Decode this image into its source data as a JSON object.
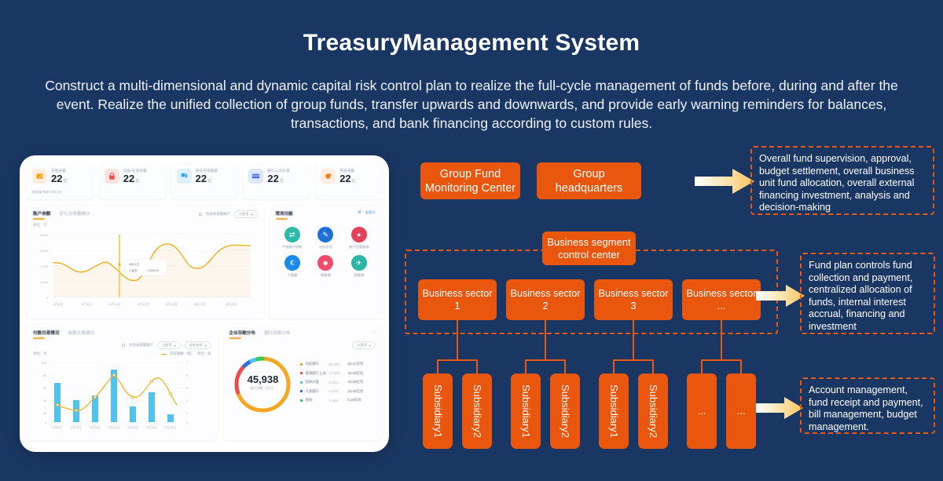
{
  "page": {
    "title": "TreasuryManagement System",
    "subtitle": "Construct a multi-dimensional and dynamic capital risk control plan to realize the full-cycle management of funds before, during and after the event. Realize the unified collection of group funds, transfer upwards and downwards, and provide early warning reminders for balances, transactions, and bank financing according to custom rules.",
    "colors": {
      "background": "#1a3764",
      "accent_orange": "#e8570d",
      "arrow_gold": "#f8c25c",
      "text_white": "#ffffff"
    }
  },
  "diagram": {
    "level1": {
      "boxes": [
        {
          "label": "Group Fund\nMonitoring Center",
          "name": "group-fund-monitoring-center"
        },
        {
          "label": "Group\nheadquarters",
          "name": "group-headquarters"
        }
      ],
      "note": "Overall fund supervision, approval, budget settlement, overall business unit fund allocation, overall external financing investment, analysis and decision-making"
    },
    "level2": {
      "control_center": "Business segment\ncontrol center",
      "sectors": [
        "Business sector\n1",
        "Business sector\n2",
        "Business sector\n3",
        "Business sector\n..."
      ],
      "note": "Fund plan controls fund collection and payment, centralized allocation of funds, internal interest accrual, financing and investment"
    },
    "level3": {
      "groups": [
        [
          "Subsidiary1",
          "Subsidiary2"
        ],
        [
          "Subsidiary1",
          "Subsidiary2"
        ],
        [
          "Subsidiary1",
          "Subsidiary2"
        ],
        [
          "...",
          "..."
        ]
      ],
      "note": "Account management, fund receipt and payment, bill management, budget management."
    }
  },
  "dashboard": {
    "kpis": [
      {
        "label": "可用金额",
        "value": "22",
        "unit": "亿",
        "sub": "保证金  ¥287,663.30",
        "icon": "wallet-icon",
        "icon_bg": "#ffeedd",
        "icon_color": "#f5a623"
      },
      {
        "label": "冻结/在途金额",
        "value": "22",
        "unit": "亿",
        "sub": "",
        "icon": "lock-icon",
        "icon_bg": "#ffe3e3",
        "icon_color": "#ef4b4b"
      },
      {
        "label": "授信可用额度",
        "value": "22",
        "unit": "亿",
        "sub": "",
        "icon": "layers-icon",
        "icon_bg": "#dff0ff",
        "icon_color": "#29a3f5"
      },
      {
        "label": "银行公司存款",
        "value": "22",
        "unit": "亿",
        "sub": "",
        "icon": "card-icon",
        "icon_bg": "#dfe7ff",
        "icon_color": "#4a6cf0"
      },
      {
        "label": "理财金额",
        "value": "22",
        "unit": "亿",
        "sub": "",
        "icon": "piggybank-icon",
        "icon_bg": "#ffeedd",
        "icon_color": "#f57c20"
      }
    ],
    "balance_panel": {
      "tab_active": "账户余额",
      "tab_inactive": "近七日流量统计",
      "checkbox_label": "包含未直联账户",
      "currency": "人民币",
      "unit_label": "单位：万",
      "tooltip": {
        "date": "4月11日",
        "series": "人民币",
        "value": "2,506.06"
      }
    },
    "transaction_panel": {
      "tab_active": "付款交易情况",
      "tab_inactive": "收款交易情况",
      "checkbox_label": "包含未直联账户",
      "currency": "人民币",
      "type": "对外支付",
      "unit_left": "单位：万",
      "unit_right": "单位：笔",
      "legend": "交易笔数（笔）"
    },
    "deposit_panel": {
      "tab_active": "企业存款分布",
      "tab_inactive": "银行存款分布",
      "currency": "人民币",
      "center_value": "45,938",
      "center_sub": "账户余额（万元）"
    },
    "quick_panel": {
      "title": "常用功能",
      "customize": "自定义",
      "items": [
        {
          "label": "个金账户转账",
          "icon": "transfer-icon",
          "color": "#2fb9a8"
        },
        {
          "label": "对外支付",
          "icon": "payment-icon",
          "color": "#1f6fd6"
        },
        {
          "label": "账户交易查询",
          "icon": "account-icon",
          "color": "#e5405a"
        },
        {
          "label": "个税通",
          "icon": "tax-icon",
          "color": "#1c8ae8"
        },
        {
          "label": "报销通",
          "icon": "expense-icon",
          "color": "#ef4b6b"
        },
        {
          "label": "差旅通",
          "icon": "travel-icon",
          "color": "#2bb6a6"
        }
      ]
    }
  },
  "chart_data": [
    {
      "type": "line",
      "name": "account-balance-trend",
      "title": "账户余额",
      "ylabel": "单位：万",
      "ylim": [
        0,
        4000
      ],
      "yticks": [
        0,
        1000,
        2000,
        3000,
        4000
      ],
      "ytick_labels": [
        "0",
        "1,000",
        "2,000",
        "3,000",
        "4,000"
      ],
      "categories": [
        "4月8日",
        "4月9日",
        "4月10日",
        "4月11日",
        "4月12日",
        "4月13日",
        "4月14日",
        "4月15日"
      ],
      "series": [
        {
          "name": "人民币",
          "values": [
            2480,
            2390,
            2180,
            2300,
            2560,
            1900,
            3700,
            2450,
            3480
          ]
        }
      ],
      "marker": {
        "x": "4月11日",
        "value": "2,506.06"
      },
      "color": "#f0b429",
      "grid": true,
      "legend": "none"
    },
    {
      "type": "bar",
      "name": "payment-transactions",
      "title": "付款交易情况",
      "ylabel": "单位：万",
      "y2label": "单位：笔",
      "ylim": [
        0,
        100
      ],
      "yticks": [
        0,
        20,
        40,
        60,
        80,
        100
      ],
      "y2lim": [
        0,
        7
      ],
      "y2ticks": [
        0,
        1,
        2,
        3,
        4,
        5,
        6,
        7
      ],
      "categories": [
        "4月9日",
        "4月10日",
        "4月11日",
        "4月12日",
        "4月13日",
        "4月14日",
        "4月15日"
      ],
      "series": [
        {
          "name": "付款金额（万）",
          "type": "bar",
          "values": [
            62,
            35,
            42,
            84,
            25,
            48,
            12
          ],
          "color": "#4ec3f0"
        },
        {
          "name": "交易笔数（笔）",
          "type": "line",
          "values": [
            1.4,
            0.9,
            2.6,
            5.1,
            3.2,
            6.1,
            1.6
          ],
          "color": "#f0b429"
        }
      ],
      "grid": true,
      "legend": "top-right"
    },
    {
      "type": "pie",
      "name": "enterprise-deposit-distribution",
      "title": "企业存款分布",
      "center_value": "45,938",
      "center_label": "账户余额（万元）",
      "slices": [
        {
          "label": "为民银行",
          "percent": "69.33%",
          "value": "90.22万元",
          "color": "#f5a623"
        },
        {
          "label": "富德银行上海",
          "percent": "17.53%",
          "value": "46.30亿元",
          "color": "#ef4b4b"
        },
        {
          "label": "招商大股",
          "percent": "5.23%",
          "value": "40.68亿元",
          "color": "#4ec3f0"
        },
        {
          "label": "工商银行",
          "percent": "4.52%",
          "value": "29.40亿元",
          "color": "#2f6fe0"
        },
        {
          "label": "其他",
          "percent": "3.18%",
          "value": "5.20亿元",
          "color": "#34c759"
        }
      ],
      "legend": "right"
    }
  ]
}
